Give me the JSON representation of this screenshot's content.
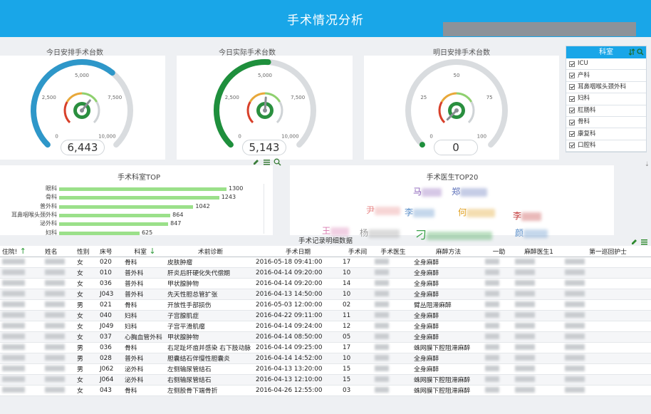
{
  "header": {
    "title": "手术情况分析"
  },
  "gauges": [
    {
      "title": "今日安排手术台数",
      "value": "6,443",
      "ticks": [
        "0",
        "2,500",
        "5,000",
        "7,500",
        "10,000"
      ],
      "max": 10000,
      "current": 6443,
      "fill_color": "#2e97c9"
    },
    {
      "title": "今日实际手术台数",
      "value": "5,143",
      "ticks": [
        "0",
        "2,500",
        "5,000",
        "7,500",
        "10,000"
      ],
      "max": 10000,
      "current": 5143,
      "fill_color": "#1e8f3c"
    },
    {
      "title": "明日安排手术台数",
      "value": "0",
      "ticks": [
        "0",
        "25",
        "50",
        "75",
        "100"
      ],
      "max": 100,
      "current": 0,
      "fill_color": "#1e8f3c"
    }
  ],
  "filter": {
    "title": "科室",
    "items": [
      "ICU",
      "产科",
      "耳鼻咽喉头颈外科",
      "妇科",
      "肛肠科",
      "骨科",
      "康复科",
      "口腔科"
    ]
  },
  "dept_top": {
    "title": "手术科室TOP",
    "chart_data": {
      "type": "bar",
      "categories": [
        "眼科",
        "骨科",
        "普外科",
        "耳鼻咽喉头颈外科",
        "泌外科",
        "妇科"
      ],
      "values": [
        1300,
        1243,
        1042,
        864,
        847,
        625
      ],
      "title": "手术科室TOP",
      "xlabel": "",
      "ylabel": ""
    }
  },
  "doctor_top": {
    "title": "手术医生TOP20",
    "words": [
      {
        "text": "马",
        "color": "#8a60b8"
      },
      {
        "text": "郑",
        "color": "#5b6fb8"
      },
      {
        "text": "尹",
        "color": "#e88a8a"
      },
      {
        "text": "李",
        "color": "#5a8ec8"
      },
      {
        "text": "何",
        "color": "#e0a020"
      },
      {
        "text": "李",
        "color": "#c23a3a"
      },
      {
        "text": "王",
        "color": "#d87ab0"
      },
      {
        "text": "杨",
        "color": "#999999"
      },
      {
        "text": "刁",
        "color": "#3aa24a"
      },
      {
        "text": "颜",
        "color": "#5a8ec8"
      }
    ]
  },
  "table": {
    "title": "手术记录明细数据",
    "columns": [
      "住院!",
      "姓名",
      "性别",
      "床号",
      "科室",
      "术前诊断",
      "手术日期",
      "手术间",
      "手术医生",
      "麻醉方法",
      "一助",
      "麻醉医生1",
      "第一巡回护士"
    ],
    "rows": [
      [
        "女",
        "020",
        "骨科",
        "皮肤肿瘤",
        "2016-05-18 09:41:00",
        "17",
        "全身麻醉"
      ],
      [
        "女",
        "010",
        "普外科",
        "肝炎后肝硬化失代偿期",
        "2016-04-14 09:20:00",
        "10",
        "全身麻醉"
      ],
      [
        "女",
        "036",
        "普外科",
        "甲状腺肿物",
        "2016-04-14 09:20:00",
        "14",
        "全身麻醉"
      ],
      [
        "女",
        "J043",
        "普外科",
        "先天性胆总管扩张",
        "2016-04-13 14:50:00",
        "10",
        "全身麻醉"
      ],
      [
        "男",
        "021",
        "骨科",
        "开放性手部损伤",
        "2016-05-03 12:00:00",
        "02",
        "臂丛阻滞麻醉"
      ],
      [
        "女",
        "040",
        "妇科",
        "子宫腺肌症",
        "2016-04-22 09:11:00",
        "11",
        "全身麻醉"
      ],
      [
        "女",
        "J049",
        "妇科",
        "子宫平滑肌瘤",
        "2016-04-14 09:24:00",
        "12",
        "全身麻醉"
      ],
      [
        "女",
        "037",
        "心胸血管外科",
        "甲状腺肿物",
        "2016-04-14 08:50:00",
        "05",
        "全身麻醉"
      ],
      [
        "男",
        "036",
        "骨科",
        "右足趾坏疽并感染 右下肢动脉",
        "2016-04-14 09:25:00",
        "17",
        "蛛网膜下腔阻滞麻醉"
      ],
      [
        "男",
        "028",
        "普外科",
        "胆囊结石伴慢性胆囊炎",
        "2016-04-14 14:52:00",
        "10",
        "全身麻醉"
      ],
      [
        "男",
        "J062",
        "泌外科",
        "左侧输尿管结石",
        "2016-04-13 13:20:00",
        "15",
        "全身麻醉"
      ],
      [
        "女",
        "J064",
        "泌外科",
        "右侧输尿管结石",
        "2016-04-13 12:10:00",
        "15",
        "蛛网膜下腔阻滞麻醉"
      ],
      [
        "女",
        "043",
        "骨科",
        "左侧股骨下端骨折",
        "2016-04-26 12:55:00",
        "03",
        "蛛网膜下腔阻滞麻醉"
      ]
    ]
  }
}
